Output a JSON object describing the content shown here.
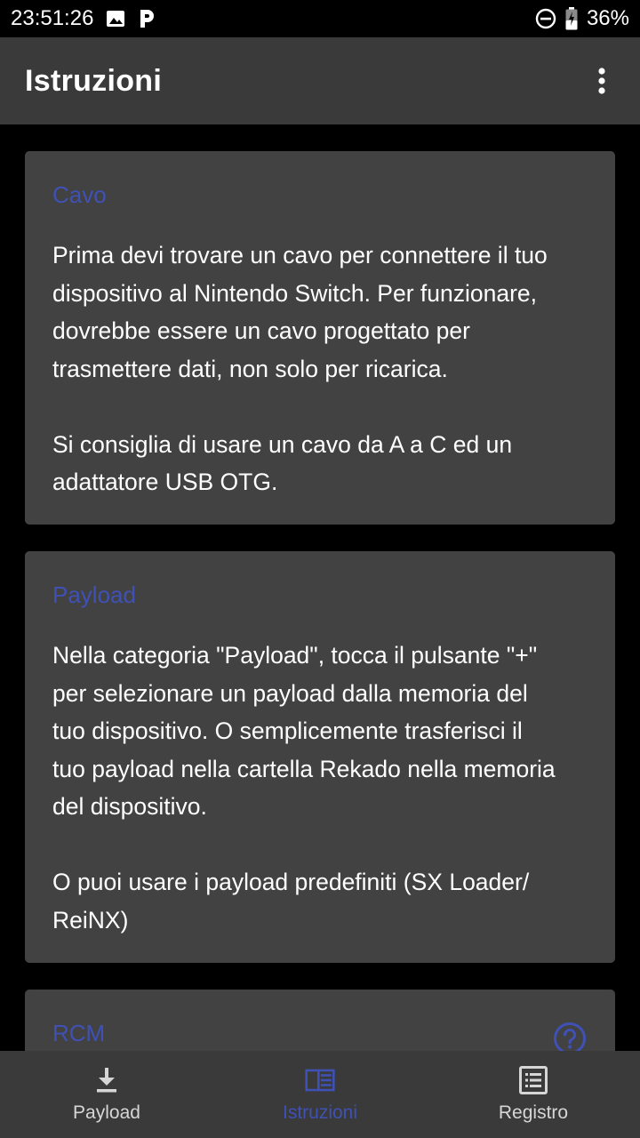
{
  "status_bar": {
    "time": "23:51:26",
    "battery": "36%",
    "icons": [
      "image-icon",
      "p-notification-icon",
      "do-not-disturb-icon",
      "battery-charging-icon"
    ]
  },
  "app_bar": {
    "title": "Istruzioni",
    "menu_icon": "more-vert-icon"
  },
  "cards": [
    {
      "title": "Cavo",
      "body": "Prima devi trovare un cavo per connettere il tuo\ndispositivo al Nintendo Switch. Per funzionare,\ndovrebbe essere un cavo progettato per\ntrasmettere dati, non solo per ricarica.\n\nSi consiglia di usare un cavo da A a C ed un\nadattatore USB OTG."
    },
    {
      "title": "Payload",
      "body": "Nella categoria \"Payload\", tocca il pulsante \"+\"\nper selezionare un payload dalla memoria del\ntuo dispositivo. O semplicemente trasferisci il\ntuo payload nella cartella Rekado nella memoria\ndel dispositivo.\n\nO puoi usare i payload predefiniti (SX Loader/\nReiNX)"
    },
    {
      "title": "RCM",
      "help_icon": "help-circle-icon"
    }
  ],
  "bottom_nav": {
    "items": [
      {
        "label": "Payload",
        "icon": "download-icon",
        "active": false
      },
      {
        "label": "Istruzioni",
        "icon": "book-icon",
        "active": true
      },
      {
        "label": "Registro",
        "icon": "list-icon",
        "active": false
      }
    ],
    "active_color": "#3f51b5",
    "inactive_color": "#d6d6d6"
  },
  "colors": {
    "accent": "#3f51b5",
    "card_bg": "#424242",
    "bar_bg": "#3a3a3a",
    "background": "#000000"
  }
}
